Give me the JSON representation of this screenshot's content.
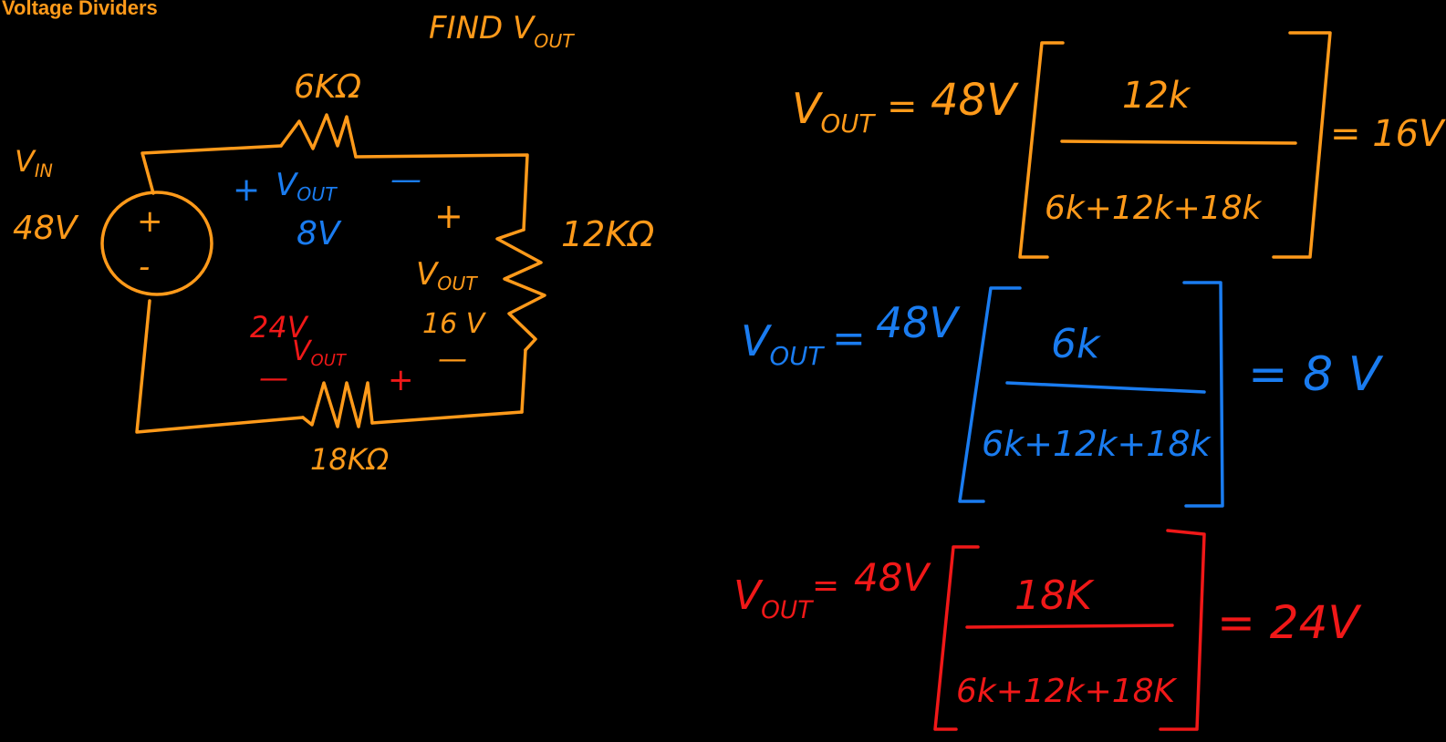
{
  "title": "Voltage Dividers",
  "colors": {
    "orange": "#ff9a1a",
    "blue": "#1a7cf0",
    "red": "#f01818",
    "bg": "#000000"
  },
  "instruction": {
    "main": "FIND V",
    "sub": "OUT"
  },
  "source": {
    "label_main": "V",
    "label_sub": "IN",
    "value": "48V",
    "plus": "+",
    "minus": "-"
  },
  "resistors": {
    "r1": "6KΩ",
    "r2": "12KΩ",
    "r3": "18KΩ"
  },
  "circuit_labels": {
    "r1_plus": "+",
    "r1_vout_main": "V",
    "r1_vout_sub": "OUT",
    "r1_minus": "—",
    "r1_value": "8V",
    "r2_plus": "+",
    "r2_vout_main": "V",
    "r2_vout_sub": "OUT",
    "r2_value": "16 V",
    "r2_minus": "—",
    "r3_value": "24V",
    "r3_vout_main": "V",
    "r3_vout_sub": "OUT",
    "r3_minus": "—",
    "r3_plus": "+"
  },
  "equations": [
    {
      "vout_main": "V",
      "vout_sub": "OUT",
      "equals": "=",
      "vin": "48V",
      "numerator": "12k",
      "denominator": "6k+12k+18k",
      "result": "= 16V"
    },
    {
      "vout_main": "V",
      "vout_sub": "OUT",
      "equals": "=",
      "vin": "48V",
      "numerator": "6k",
      "denominator": "6k+12k+18k",
      "result": "= 8 V"
    },
    {
      "vout_main": "V",
      "vout_sub": "OUT",
      "equals": "=",
      "vin": "48V",
      "numerator": "18K",
      "denominator": "6k+12k+18K",
      "result": "= 24V"
    }
  ]
}
